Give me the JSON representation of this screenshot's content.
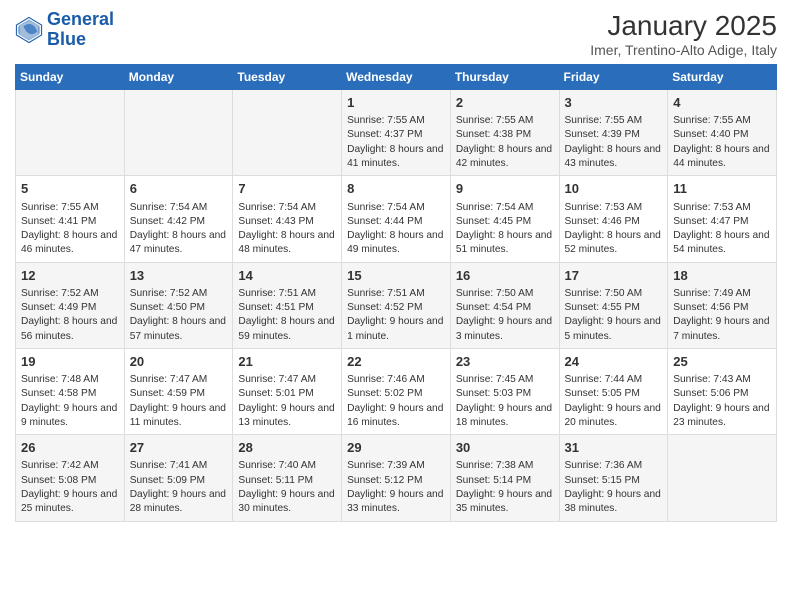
{
  "logo": {
    "line1": "General",
    "line2": "Blue"
  },
  "title": "January 2025",
  "subtitle": "Imer, Trentino-Alto Adige, Italy",
  "days_of_week": [
    "Sunday",
    "Monday",
    "Tuesday",
    "Wednesday",
    "Thursday",
    "Friday",
    "Saturday"
  ],
  "weeks": [
    [
      {
        "day": "",
        "content": ""
      },
      {
        "day": "",
        "content": ""
      },
      {
        "day": "",
        "content": ""
      },
      {
        "day": "1",
        "content": "Sunrise: 7:55 AM\nSunset: 4:37 PM\nDaylight: 8 hours and 41 minutes."
      },
      {
        "day": "2",
        "content": "Sunrise: 7:55 AM\nSunset: 4:38 PM\nDaylight: 8 hours and 42 minutes."
      },
      {
        "day": "3",
        "content": "Sunrise: 7:55 AM\nSunset: 4:39 PM\nDaylight: 8 hours and 43 minutes."
      },
      {
        "day": "4",
        "content": "Sunrise: 7:55 AM\nSunset: 4:40 PM\nDaylight: 8 hours and 44 minutes."
      }
    ],
    [
      {
        "day": "5",
        "content": "Sunrise: 7:55 AM\nSunset: 4:41 PM\nDaylight: 8 hours and 46 minutes."
      },
      {
        "day": "6",
        "content": "Sunrise: 7:54 AM\nSunset: 4:42 PM\nDaylight: 8 hours and 47 minutes."
      },
      {
        "day": "7",
        "content": "Sunrise: 7:54 AM\nSunset: 4:43 PM\nDaylight: 8 hours and 48 minutes."
      },
      {
        "day": "8",
        "content": "Sunrise: 7:54 AM\nSunset: 4:44 PM\nDaylight: 8 hours and 49 minutes."
      },
      {
        "day": "9",
        "content": "Sunrise: 7:54 AM\nSunset: 4:45 PM\nDaylight: 8 hours and 51 minutes."
      },
      {
        "day": "10",
        "content": "Sunrise: 7:53 AM\nSunset: 4:46 PM\nDaylight: 8 hours and 52 minutes."
      },
      {
        "day": "11",
        "content": "Sunrise: 7:53 AM\nSunset: 4:47 PM\nDaylight: 8 hours and 54 minutes."
      }
    ],
    [
      {
        "day": "12",
        "content": "Sunrise: 7:52 AM\nSunset: 4:49 PM\nDaylight: 8 hours and 56 minutes."
      },
      {
        "day": "13",
        "content": "Sunrise: 7:52 AM\nSunset: 4:50 PM\nDaylight: 8 hours and 57 minutes."
      },
      {
        "day": "14",
        "content": "Sunrise: 7:51 AM\nSunset: 4:51 PM\nDaylight: 8 hours and 59 minutes."
      },
      {
        "day": "15",
        "content": "Sunrise: 7:51 AM\nSunset: 4:52 PM\nDaylight: 9 hours and 1 minute."
      },
      {
        "day": "16",
        "content": "Sunrise: 7:50 AM\nSunset: 4:54 PM\nDaylight: 9 hours and 3 minutes."
      },
      {
        "day": "17",
        "content": "Sunrise: 7:50 AM\nSunset: 4:55 PM\nDaylight: 9 hours and 5 minutes."
      },
      {
        "day": "18",
        "content": "Sunrise: 7:49 AM\nSunset: 4:56 PM\nDaylight: 9 hours and 7 minutes."
      }
    ],
    [
      {
        "day": "19",
        "content": "Sunrise: 7:48 AM\nSunset: 4:58 PM\nDaylight: 9 hours and 9 minutes."
      },
      {
        "day": "20",
        "content": "Sunrise: 7:47 AM\nSunset: 4:59 PM\nDaylight: 9 hours and 11 minutes."
      },
      {
        "day": "21",
        "content": "Sunrise: 7:47 AM\nSunset: 5:01 PM\nDaylight: 9 hours and 13 minutes."
      },
      {
        "day": "22",
        "content": "Sunrise: 7:46 AM\nSunset: 5:02 PM\nDaylight: 9 hours and 16 minutes."
      },
      {
        "day": "23",
        "content": "Sunrise: 7:45 AM\nSunset: 5:03 PM\nDaylight: 9 hours and 18 minutes."
      },
      {
        "day": "24",
        "content": "Sunrise: 7:44 AM\nSunset: 5:05 PM\nDaylight: 9 hours and 20 minutes."
      },
      {
        "day": "25",
        "content": "Sunrise: 7:43 AM\nSunset: 5:06 PM\nDaylight: 9 hours and 23 minutes."
      }
    ],
    [
      {
        "day": "26",
        "content": "Sunrise: 7:42 AM\nSunset: 5:08 PM\nDaylight: 9 hours and 25 minutes."
      },
      {
        "day": "27",
        "content": "Sunrise: 7:41 AM\nSunset: 5:09 PM\nDaylight: 9 hours and 28 minutes."
      },
      {
        "day": "28",
        "content": "Sunrise: 7:40 AM\nSunset: 5:11 PM\nDaylight: 9 hours and 30 minutes."
      },
      {
        "day": "29",
        "content": "Sunrise: 7:39 AM\nSunset: 5:12 PM\nDaylight: 9 hours and 33 minutes."
      },
      {
        "day": "30",
        "content": "Sunrise: 7:38 AM\nSunset: 5:14 PM\nDaylight: 9 hours and 35 minutes."
      },
      {
        "day": "31",
        "content": "Sunrise: 7:36 AM\nSunset: 5:15 PM\nDaylight: 9 hours and 38 minutes."
      },
      {
        "day": "",
        "content": ""
      }
    ]
  ]
}
